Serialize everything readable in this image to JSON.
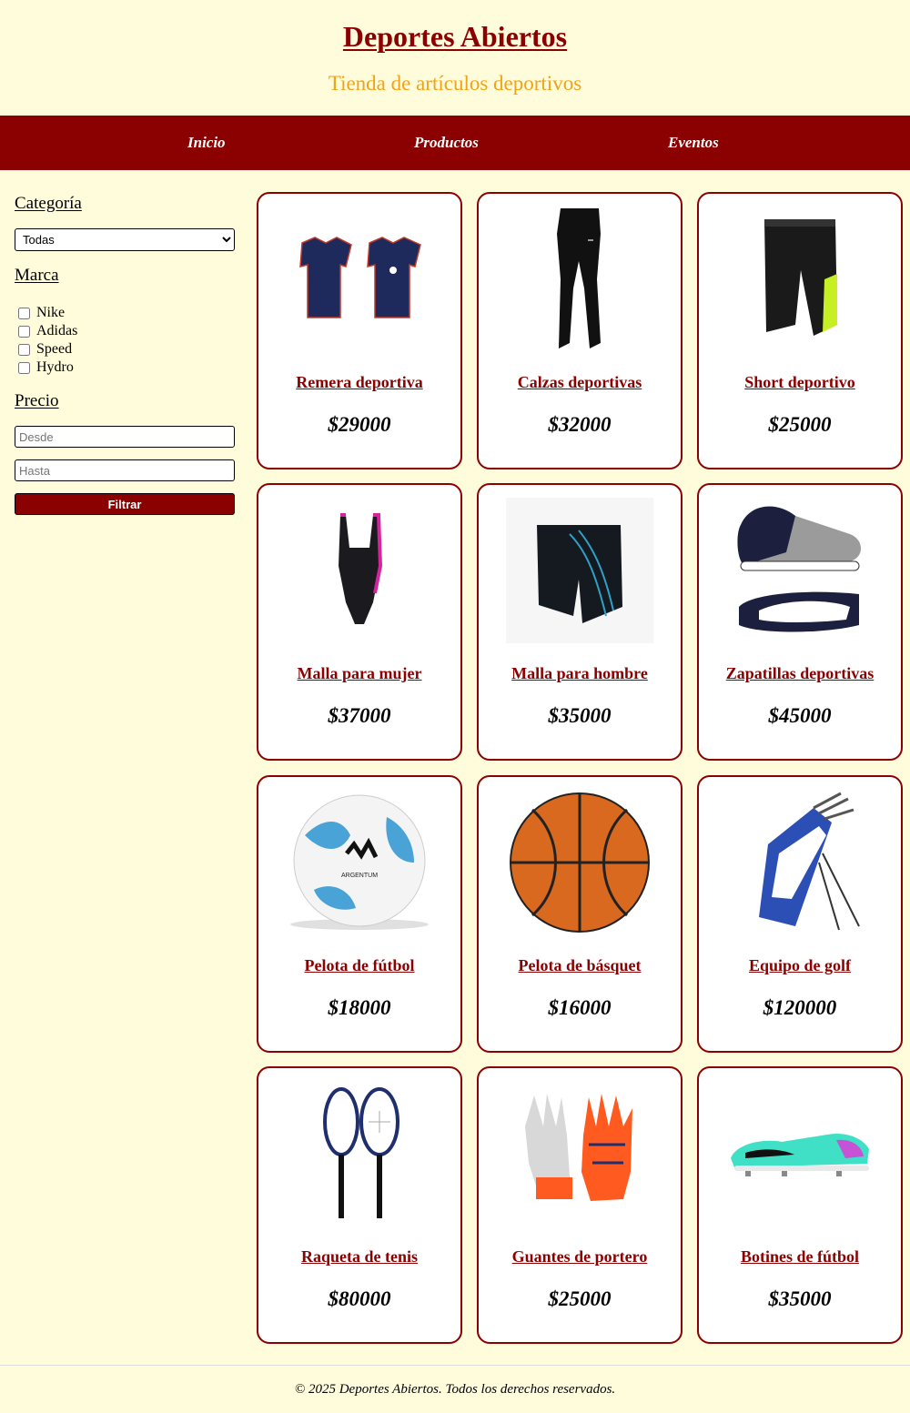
{
  "header": {
    "title": "Deportes Abiertos",
    "tagline": "Tienda de artículos deportivos"
  },
  "nav": {
    "items": [
      {
        "label": "Inicio"
      },
      {
        "label": "Productos"
      },
      {
        "label": "Eventos"
      }
    ]
  },
  "sidebar": {
    "category_title": "Categoría",
    "category_selected": "Todas",
    "brand_title": "Marca",
    "brands": [
      "Nike",
      "Adidas",
      "Speed",
      "Hydro"
    ],
    "price_title": "Precio",
    "from_placeholder": "Desde",
    "to_placeholder": "Hasta",
    "filter_button": "Filtrar"
  },
  "products": [
    {
      "name": "Remera deportiva",
      "price": "$29000",
      "icon": "tshirt-icon"
    },
    {
      "name": "Calzas deportivas",
      "price": "$32000",
      "icon": "leggings-icon"
    },
    {
      "name": "Short deportivo",
      "price": "$25000",
      "icon": "shorts-icon"
    },
    {
      "name": "Malla para mujer",
      "price": "$37000",
      "icon": "swimsuit-icon"
    },
    {
      "name": "Malla para hombre",
      "price": "$35000",
      "icon": "swim-trunks-icon"
    },
    {
      "name": "Zapatillas deportivas",
      "price": "$45000",
      "icon": "sneakers-icon"
    },
    {
      "name": "Pelota de fútbol",
      "price": "$18000",
      "icon": "soccer-ball-icon"
    },
    {
      "name": "Pelota de básquet",
      "price": "$16000",
      "icon": "basketball-icon"
    },
    {
      "name": "Equipo de golf",
      "price": "$120000",
      "icon": "golf-bag-icon"
    },
    {
      "name": "Raqueta de tenis",
      "price": "$80000",
      "icon": "tennis-racket-icon"
    },
    {
      "name": "Guantes de portero",
      "price": "$25000",
      "icon": "goalkeeper-gloves-icon"
    },
    {
      "name": "Botines de fútbol",
      "price": "$35000",
      "icon": "football-boots-icon"
    }
  ],
  "footer": {
    "text": "© 2025 Deportes Abiertos. Todos los derechos reservados."
  },
  "colors": {
    "background": "#fffcdc",
    "brand": "#8b0000",
    "tagline": "#f2a213"
  }
}
